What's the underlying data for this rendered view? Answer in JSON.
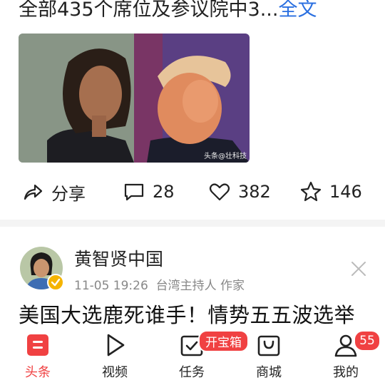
{
  "post": {
    "text_partial": "全部435个席位及参议院中3...",
    "more_label": "全文",
    "watermark": "头条@壮科技",
    "actions": {
      "share_label": "分享",
      "comments": "28",
      "likes": "382",
      "favorites": "146"
    }
  },
  "next_post": {
    "author": "黄智贤中国",
    "time": "11-05 19:26",
    "author_desc": "台湾主持人 作家",
    "title": "美国大选鹿死谁手！情势五五波选举"
  },
  "tabbar": {
    "items": [
      {
        "label": "头条",
        "icon": "toutiao-icon"
      },
      {
        "label": "视频",
        "icon": "play-icon"
      },
      {
        "label": "任务",
        "icon": "task-icon"
      },
      {
        "label": "商城",
        "icon": "shop-bag-icon"
      },
      {
        "label": "我的",
        "icon": "profile-icon"
      }
    ],
    "task_badge": "开宝箱",
    "profile_badge": "55"
  },
  "colors": {
    "accent": "#f04142",
    "link": "#2a6fe0"
  }
}
